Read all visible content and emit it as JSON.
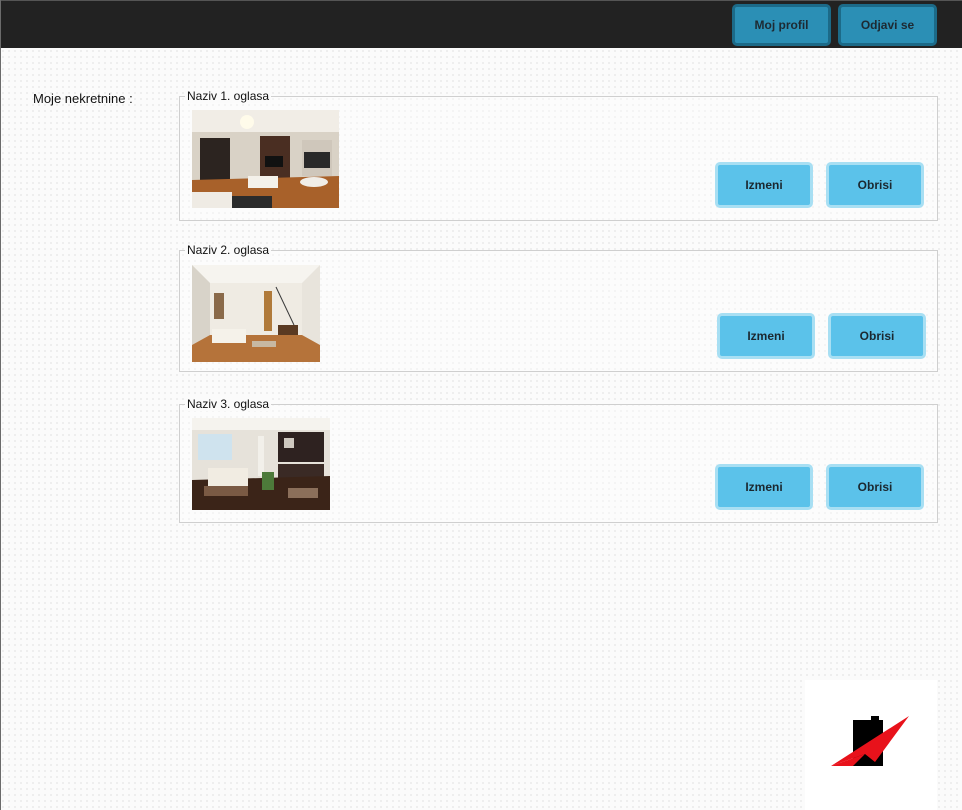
{
  "header": {
    "profile_label": "Moj profil",
    "logout_label": "Odjavi se"
  },
  "main": {
    "section_label": "Moje nekretnine :",
    "listings": [
      {
        "title": "Naziv 1. oglasa",
        "image": "living-room-photo",
        "edit_label": "Izmeni",
        "delete_label": "Obrisi"
      },
      {
        "title": "Naziv 2. oglasa",
        "image": "living-room-photo",
        "edit_label": "Izmeni",
        "delete_label": "Obrisi"
      },
      {
        "title": "Naziv 3. oglasa",
        "image": "living-room-photo",
        "edit_label": "Izmeni",
        "delete_label": "Obrisi"
      }
    ]
  },
  "colors": {
    "topbar": "#222222",
    "nav_button": "#2b8fb5",
    "action_button": "#5bc2ea",
    "logo_red": "#e8121b"
  }
}
